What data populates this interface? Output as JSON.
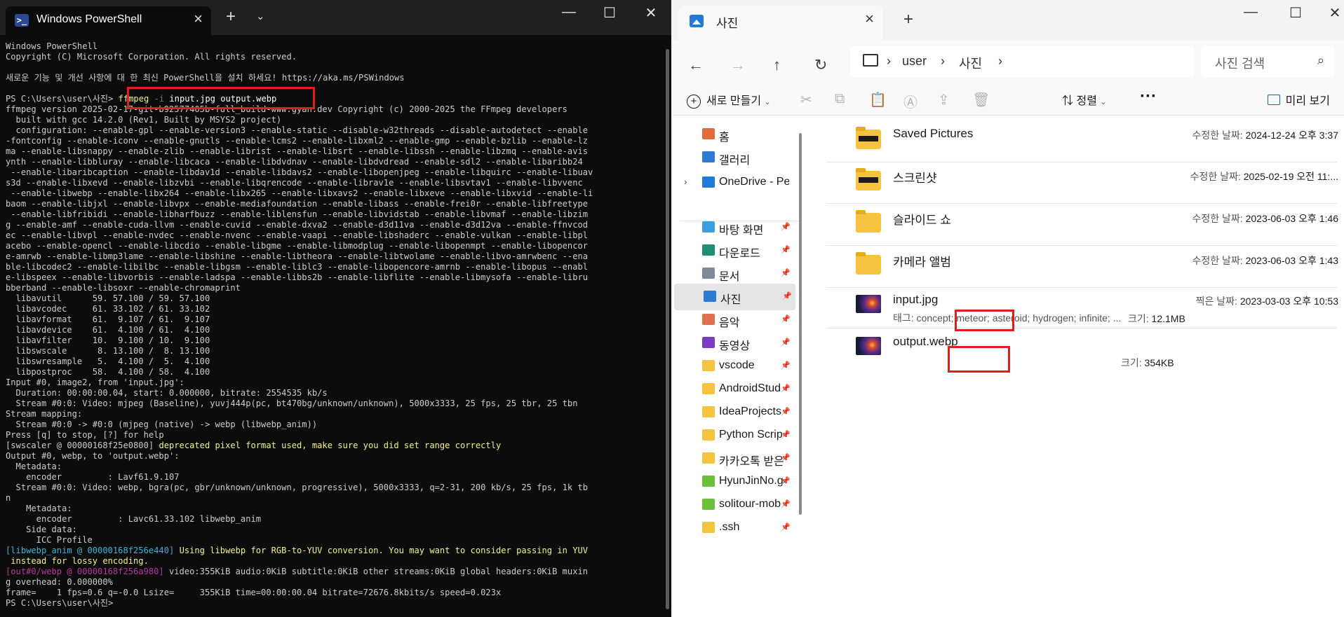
{
  "powershell": {
    "tab_title": "Windows PowerShell",
    "lines": [
      {
        "text": "Windows PowerShell"
      },
      {
        "text": "Copyright (C) Microsoft Corporation. All rights reserved."
      },
      {
        "text": ""
      },
      {
        "text": "새로운 기능 및 개선 사항에 대 한 최신 PowerShell을 설치 하세요! https://aka.ms/PSWindows"
      },
      {
        "text": ""
      },
      {
        "segments": [
          {
            "t": "PS C:\\Users\\user\\사진> "
          },
          {
            "t": "ffmpeg",
            "c": "c-yel"
          },
          {
            "t": " -i",
            "c": "c-gray"
          },
          {
            "t": " input.jpg output.webp",
            "c": "c-white"
          }
        ]
      },
      {
        "text": "ffmpeg version 2025-02-17-git-b92577405b-full_build-www.gyan.dev Copyright (c) 2000-2025 the FFmpeg developers"
      },
      {
        "text": "  built with gcc 14.2.0 (Rev1, Built by MSYS2 project)"
      },
      {
        "text": "  configuration: --enable-gpl --enable-version3 --enable-static --disable-w32threads --disable-autodetect --enable"
      },
      {
        "text": "-fontconfig --enable-iconv --enable-gnutls --enable-lcms2 --enable-libxml2 --enable-gmp --enable-bzlib --enable-lz"
      },
      {
        "text": "ma --enable-libsnappy --enable-zlib --enable-librist --enable-libsrt --enable-libssh --enable-libzmq --enable-avis"
      },
      {
        "text": "ynth --enable-libbluray --enable-libcaca --enable-libdvdnav --enable-libdvdread --enable-sdl2 --enable-libaribb24"
      },
      {
        "text": " --enable-libaribcaption --enable-libdav1d --enable-libdavs2 --enable-libopenjpeg --enable-libquirc --enable-libuav"
      },
      {
        "text": "s3d --enable-libxevd --enable-libzvbi --enable-libqrencode --enable-librav1e --enable-libsvtav1 --enable-libvvenc"
      },
      {
        "text": " --enable-libwebp --enable-libx264 --enable-libx265 --enable-libxavs2 --enable-libxeve --enable-libxvid --enable-li"
      },
      {
        "text": "baom --enable-libjxl --enable-libvpx --enable-mediafoundation --enable-libass --enable-frei0r --enable-libfreetype"
      },
      {
        "text": " --enable-libfribidi --enable-libharfbuzz --enable-liblensfun --enable-libvidstab --enable-libvmaf --enable-libzim"
      },
      {
        "text": "g --enable-amf --enable-cuda-llvm --enable-cuvid --enable-dxva2 --enable-d3d11va --enable-d3d12va --enable-ffnvcod"
      },
      {
        "text": "ec --enable-libvpl --enable-nvdec --enable-nvenc --enable-vaapi --enable-libshaderc --enable-vulkan --enable-libpl"
      },
      {
        "text": "acebo --enable-opencl --enable-libcdio --enable-libgme --enable-libmodplug --enable-libopenmpt --enable-libopencor"
      },
      {
        "text": "e-amrwb --enable-libmp3lame --enable-libshine --enable-libtheora --enable-libtwolame --enable-libvo-amrwbenc --ena"
      },
      {
        "text": "ble-libcodec2 --enable-libilbc --enable-libgsm --enable-liblc3 --enable-libopencore-amrnb --enable-libopus --enabl"
      },
      {
        "text": "e-libspeex --enable-libvorbis --enable-ladspa --enable-libbs2b --enable-libflite --enable-libmysofa --enable-libru"
      },
      {
        "text": "bberband --enable-libsoxr --enable-chromaprint"
      },
      {
        "text": "  libavutil      59. 57.100 / 59. 57.100"
      },
      {
        "text": "  libavcodec     61. 33.102 / 61. 33.102"
      },
      {
        "text": "  libavformat    61.  9.107 / 61.  9.107"
      },
      {
        "text": "  libavdevice    61.  4.100 / 61.  4.100"
      },
      {
        "text": "  libavfilter    10.  9.100 / 10.  9.100"
      },
      {
        "text": "  libswscale      8. 13.100 /  8. 13.100"
      },
      {
        "text": "  libswresample   5.  4.100 /  5.  4.100"
      },
      {
        "text": "  libpostproc    58.  4.100 / 58.  4.100"
      },
      {
        "text": "Input #0, image2, from 'input.jpg':"
      },
      {
        "text": "  Duration: 00:00:00.04, start: 0.000000, bitrate: 2554535 kb/s"
      },
      {
        "text": "  Stream #0:0: Video: mjpeg (Baseline), yuvj444p(pc, bt470bg/unknown/unknown), 5000x3333, 25 fps, 25 tbr, 25 tbn"
      },
      {
        "text": "Stream mapping:"
      },
      {
        "text": "  Stream #0:0 -> #0:0 (mjpeg (native) -> webp (libwebp_anim))"
      },
      {
        "text": "Press [q] to stop, [?] for help"
      },
      {
        "segments": [
          {
            "t": "[swscaler @ 00000168f25e0800] "
          },
          {
            "t": "deprecated pixel format used, make sure you did set range correctly",
            "c": "c-yel"
          }
        ]
      },
      {
        "text": "Output #0, webp, to 'output.webp':"
      },
      {
        "text": "  Metadata:"
      },
      {
        "text": "    encoder         : Lavf61.9.107"
      },
      {
        "text": "  Stream #0:0: Video: webp, bgra(pc, gbr/unknown/unknown, progressive), 5000x3333, q=2-31, 200 kb/s, 25 fps, 1k tb"
      },
      {
        "text": "n"
      },
      {
        "text": "    Metadata:"
      },
      {
        "text": "      encoder         : Lavc61.33.102 libwebp_anim"
      },
      {
        "text": "    Side data:"
      },
      {
        "text": "      ICC Profile"
      },
      {
        "segments": [
          {
            "t": "[libwebp_anim @ 00000168f256e440] ",
            "c": "c-cyan"
          },
          {
            "t": "Using libwebp for RGB-to-YUV conversion. You may want to consider passing in YUV",
            "c": "c-yel"
          }
        ]
      },
      {
        "segments": [
          {
            "t": " instead for lossy encoding.",
            "c": "c-yel"
          }
        ]
      },
      {
        "segments": [
          {
            "t": "[out#0/webp @ 00000168f256a980] ",
            "c": "c-mag"
          },
          {
            "t": "video:355KiB audio:0KiB subtitle:0KiB other streams:0KiB global headers:0KiB muxin"
          }
        ]
      },
      {
        "text": "g overhead: 0.000000%"
      },
      {
        "text": "frame=    1 fps=0.6 q=-0.0 Lsize=     355KiB time=00:00:00.04 bitrate=72676.8kbits/s speed=0.023x"
      },
      {
        "text": "PS C:\\Users\\user\\사진> "
      }
    ]
  },
  "explorer": {
    "tab_title": "사진",
    "breadcrumb": [
      "user",
      "사진"
    ],
    "search_placeholder": "사진 검색",
    "toolbar": {
      "new_label": "새로 만들기",
      "sort_label": "정렬",
      "more_label": "···",
      "preview_label": "미리 보기"
    },
    "sidebar": [
      {
        "label": "홈",
        "icon": "home-icon",
        "color": "#e06c3a",
        "pinned": false
      },
      {
        "label": "갤러리",
        "icon": "gallery-icon",
        "color": "#2b7bd6",
        "pinned": false
      },
      {
        "label": "OneDrive - Pers",
        "icon": "onedrive-icon",
        "color": "#1f7ad9",
        "pinned": false,
        "expandable": true
      },
      {
        "label": "바탕 화면",
        "icon": "desktop-icon",
        "color": "#3aa0e0",
        "pinned": true
      },
      {
        "label": "다운로드",
        "icon": "download-icon",
        "color": "#1e8f73",
        "pinned": true
      },
      {
        "label": "문서",
        "icon": "documents-icon",
        "color": "#7d8a9c",
        "pinned": true
      },
      {
        "label": "사진",
        "icon": "pictures-icon",
        "color": "#2b7bd6",
        "pinned": true,
        "selected": true
      },
      {
        "label": "음악",
        "icon": "music-icon",
        "color": "#e2704e",
        "pinned": true
      },
      {
        "label": "동영상",
        "icon": "videos-icon",
        "color": "#7a3cc4",
        "pinned": true
      },
      {
        "label": "vscode",
        "icon": "folder-icon",
        "color": "#f6c340",
        "pinned": true
      },
      {
        "label": "AndroidStud",
        "icon": "folder-icon",
        "color": "#f6c340",
        "pinned": true
      },
      {
        "label": "IdeaProjects",
        "icon": "folder-icon",
        "color": "#f6c340",
        "pinned": true
      },
      {
        "label": "Python Scrip",
        "icon": "folder-icon",
        "color": "#f6c340",
        "pinned": true
      },
      {
        "label": "카카오톡 받은",
        "icon": "folder-icon",
        "color": "#f6c340",
        "pinned": true
      },
      {
        "label": "HyunJinNo.g",
        "icon": "git-folder-icon",
        "color": "#6bbf3a",
        "pinned": true
      },
      {
        "label": "solitour-mob",
        "icon": "git-folder-icon",
        "color": "#6bbf3a",
        "pinned": true
      },
      {
        "label": ".ssh",
        "icon": "folder-icon",
        "color": "#f6c340",
        "pinned": true
      }
    ],
    "files": [
      {
        "name": "Saved Pictures",
        "type": "folder",
        "strip": true,
        "meta_label": "수정한 날짜:",
        "meta_value": "2024-12-24 오후 3:37"
      },
      {
        "name": "스크린샷",
        "type": "folder",
        "strip": true,
        "meta_label": "수정한 날짜:",
        "meta_value": "2025-02-19 오전 11:..."
      },
      {
        "name": "슬라이드 쇼",
        "type": "folder",
        "meta_label": "수정한 날짜:",
        "meta_value": "2023-06-03 오후 1:46"
      },
      {
        "name": "카메라 앨범",
        "type": "folder",
        "meta_label": "수정한 날짜:",
        "meta_value": "2023-06-03 오후 1:43"
      },
      {
        "name": "input.jpg",
        "type": "image",
        "meta_label": "찍은 날짜:",
        "meta_value": "2023-03-03 오후 10:53",
        "tags": "태그: concept; meteor; asteroid; hydrogen; infinite; ...",
        "size_label": "크기:",
        "size_value": "12.1MB"
      },
      {
        "name": "output.webp",
        "type": "image",
        "size_label": "크기:",
        "size_value": "354KB"
      }
    ]
  }
}
